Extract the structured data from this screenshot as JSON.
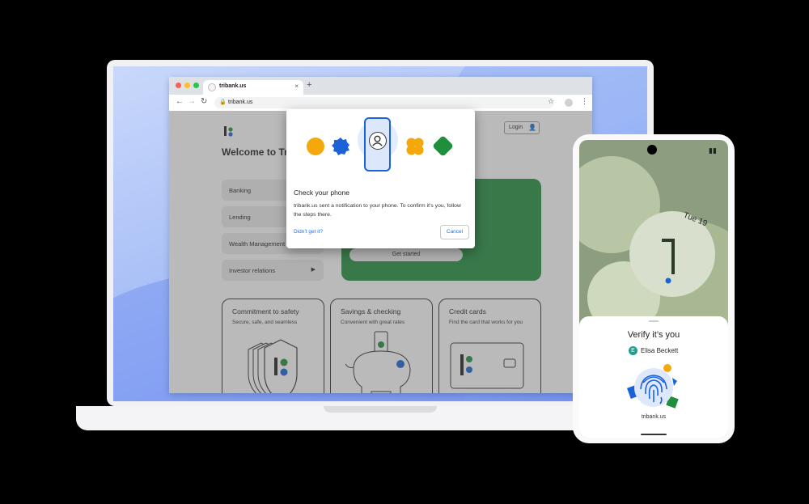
{
  "browser": {
    "tab_title": "tribank.us",
    "url": "tribank.us",
    "tab_close": "×",
    "new_tab": "+"
  },
  "site": {
    "welcome": "Welcome to Tri.Bank",
    "login_label": "Login",
    "menu": [
      {
        "label": "Banking"
      },
      {
        "label": "Lending"
      },
      {
        "label": "Wealth Management"
      },
      {
        "label": "Investor relations"
      }
    ],
    "hero_button": "Get started",
    "cards": [
      {
        "title": "Commitment to safety",
        "subtitle": "Secure, safe, and seamless"
      },
      {
        "title": "Savings & checking",
        "subtitle": "Convenient with great rates"
      },
      {
        "title": "Credit cards",
        "subtitle": "Find the card that works for you"
      }
    ]
  },
  "dialog": {
    "title": "Check your phone",
    "body": "tribank.us sent a notification to your phone. To confirm it’s you, follow the steps there.",
    "link": "Didn’t get it?",
    "cancel": "Cancel"
  },
  "phone": {
    "date": "Tue 19",
    "sheet_title": "Verify it’s you",
    "avatar_initial": "E",
    "user_name": "Elisa Beckett",
    "site": "tribank.us"
  },
  "colors": {
    "green": "#1f8e3d",
    "blue": "#1a62d8",
    "yellow": "#f4a80c",
    "link": "#1a73e8"
  }
}
